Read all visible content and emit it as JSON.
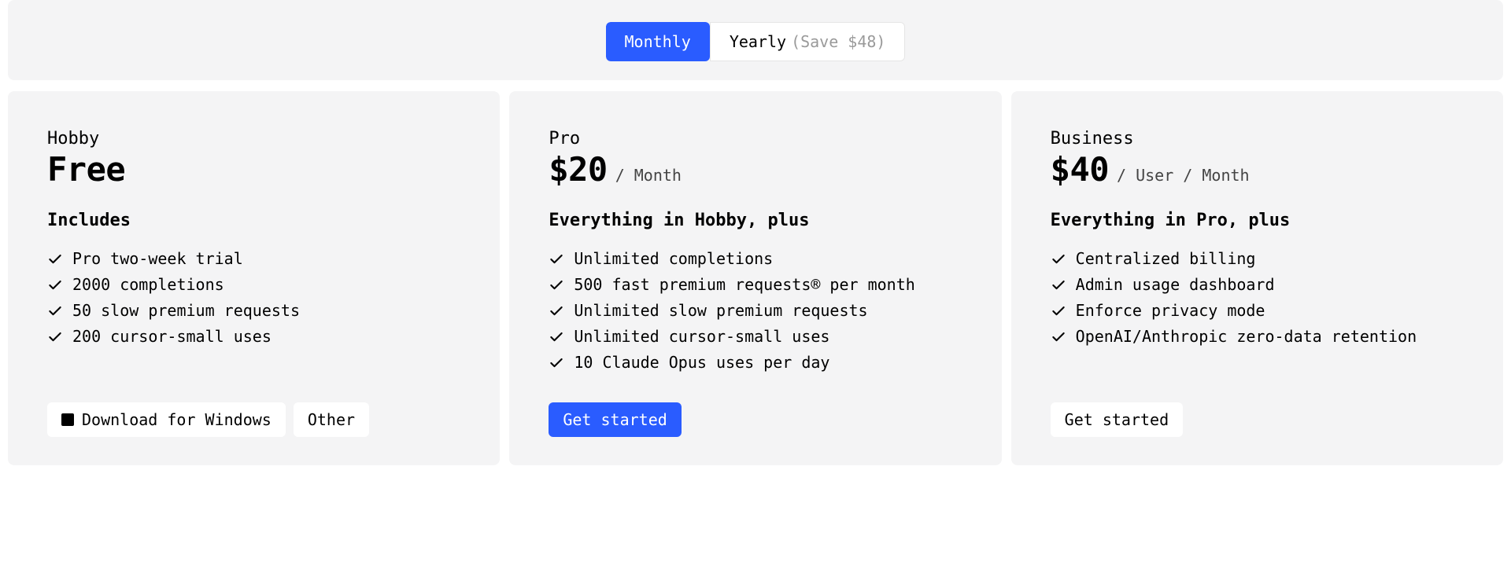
{
  "toggle": {
    "monthly": "Monthly",
    "yearly": "Yearly",
    "save": "(Save $48)"
  },
  "plans": {
    "hobby": {
      "name": "Hobby",
      "price": "Free",
      "includes": "Includes",
      "features": [
        "Pro two-week trial",
        "2000 completions",
        "50 slow premium requests",
        "200 cursor-small uses"
      ],
      "download": "Download for Windows",
      "other": "Other"
    },
    "pro": {
      "name": "Pro",
      "price": "$20",
      "per": "/ Month",
      "includes": "Everything in Hobby, plus",
      "features": [
        "Unlimited completions",
        "500 fast premium requests® per month",
        "Unlimited slow premium requests",
        "Unlimited cursor-small uses",
        "10 Claude Opus uses per day"
      ],
      "cta": "Get started"
    },
    "business": {
      "name": "Business",
      "price": "$40",
      "per": "/ User / Month",
      "includes": "Everything in Pro, plus",
      "features": [
        "Centralized billing",
        "Admin usage dashboard",
        "Enforce privacy mode",
        "OpenAI/Anthropic zero-data retention"
      ],
      "cta": "Get started"
    }
  }
}
